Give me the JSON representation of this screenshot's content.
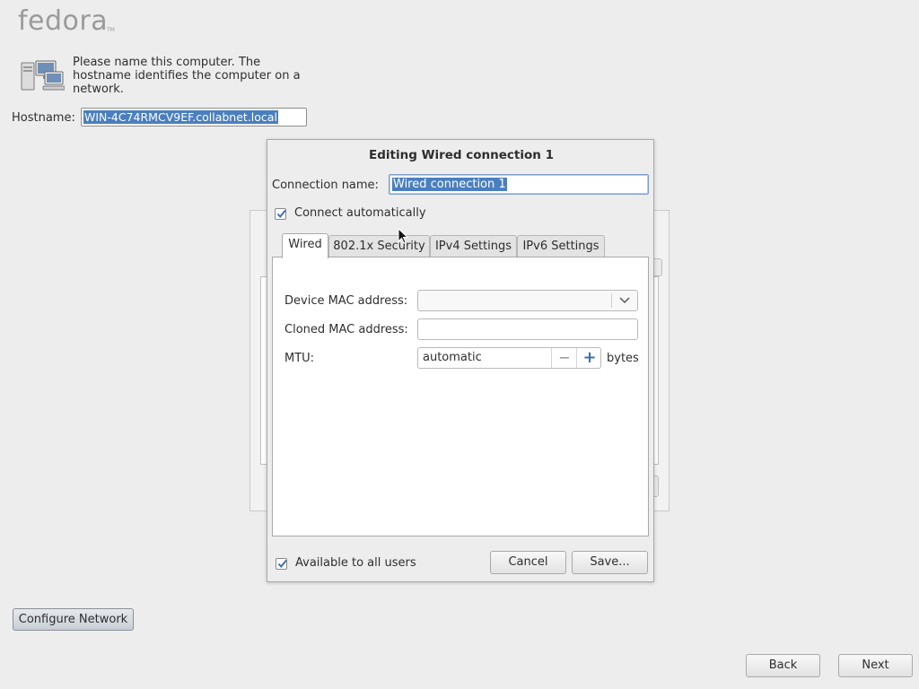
{
  "header": {
    "logo_text": "fedora",
    "logo_tm": "TM"
  },
  "hostname_section": {
    "intro_text": "Please name this computer.  The hostname identifies the computer on a network.",
    "hostname_label": "Hostname:",
    "hostname_value": "WIN-4C74RMCV9EF.collabnet.local"
  },
  "dialog": {
    "title": "Editing Wired connection 1",
    "connection_name_label": "Connection name:",
    "connection_name_value": "Wired connection 1",
    "connect_automatically_label": "Connect automatically",
    "connect_automatically_checked": true,
    "tabs": [
      {
        "label": "Wired",
        "active": true
      },
      {
        "label": "802.1x Security",
        "active": false
      },
      {
        "label": "IPv4 Settings",
        "active": false
      },
      {
        "label": "IPv6 Settings",
        "active": false
      }
    ],
    "wired": {
      "device_mac_label": "Device MAC address:",
      "device_mac_value": "",
      "cloned_mac_label": "Cloned MAC address:",
      "cloned_mac_value": "",
      "mtu_label": "MTU:",
      "mtu_value": "automatic",
      "mtu_unit": "bytes"
    },
    "available_all_users_label": "Available to all users",
    "available_all_users_checked": true,
    "cancel_label": "Cancel",
    "save_label": "Save..."
  },
  "footer": {
    "configure_network_label": "Configure Network",
    "back_label": "Back",
    "next_label": "Next"
  },
  "colors": {
    "selection": "#4a7fbf",
    "check_accent": "#3b6fb6"
  }
}
